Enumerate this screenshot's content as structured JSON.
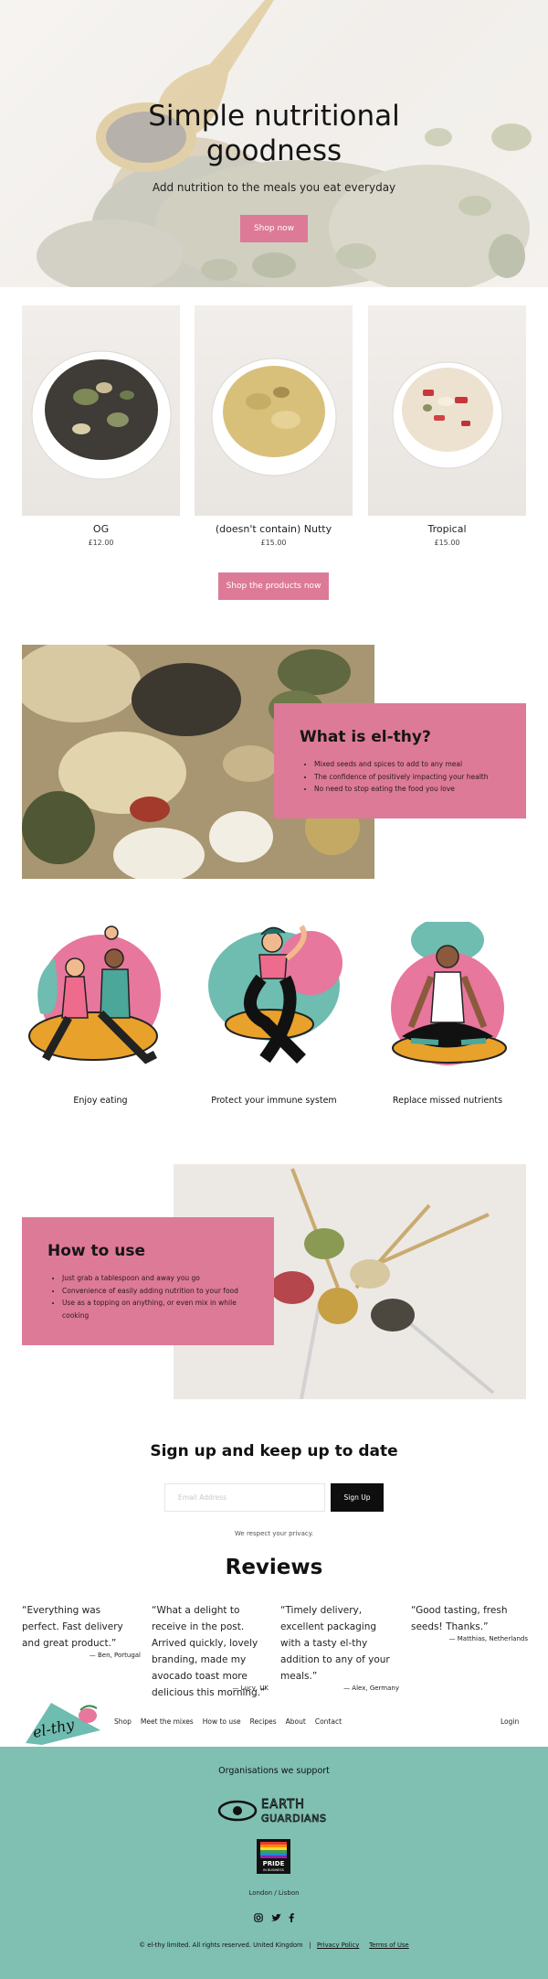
{
  "hero": {
    "title_line1": "Simple nutritional",
    "title_line2": "goodness",
    "subtitle": "Add nutrition to the meals you eat everyday",
    "cta": "Shop now"
  },
  "products": [
    {
      "name": "OG",
      "price": "£12.00"
    },
    {
      "name": "(doesn't contain) Nutty",
      "price": "£15.00"
    },
    {
      "name": "Tropical",
      "price": "£15.00"
    }
  ],
  "products_cta": "Shop the products now",
  "what_is": {
    "title": "What is el-thy?",
    "items": [
      "Mixed seeds and spices to add to any meal",
      "The confidence of positively impacting your health",
      "No need to stop eating the food you love"
    ]
  },
  "features": [
    {
      "label": "Enjoy eating"
    },
    {
      "label": "Protect your immune system"
    },
    {
      "label": "Replace missed nutrients"
    }
  ],
  "how_to_use": {
    "title": "How to use",
    "items": [
      "Just grab a tablespoon and away you go",
      "Convenience of easily adding nutrition to your food",
      "Use as a topping on anything, or even mix in while cooking"
    ]
  },
  "signup": {
    "title": "Sign up and keep up to date",
    "email_placeholder": "Email Address",
    "button": "Sign Up",
    "privacy": "We respect your privacy."
  },
  "reviews": {
    "title": "Reviews",
    "items": [
      {
        "quote": "“Everything was perfect. Fast delivery and great product.”",
        "author": "— Ben, Portugal"
      },
      {
        "quote": "“What a delight to receive in the post. Arrived quickly, lovely branding, made my avocado toast more delicious this morning.”",
        "author": "— Lucy, UK"
      },
      {
        "quote": "“Timely delivery, excellent packaging with a tasty el-thy addition to any of your meals.”",
        "author": "— Alex, Germany"
      },
      {
        "quote": "“Good tasting, fresh seeds! Thanks.”",
        "author": "— Matthias, Netherlands"
      }
    ]
  },
  "nav": {
    "logo_text": "el-thy",
    "links": [
      "Shop",
      "Meet the mixes",
      "How to use",
      "Recipes",
      "About",
      "Contact"
    ],
    "login": "Login"
  },
  "footer": {
    "org_title": "Organisations we support",
    "earth_guardians_top": "EARTH",
    "earth_guardians_bottom": "GUARDIANS",
    "pride_line1": "PRIDE",
    "pride_line2": "IN BUSINESS",
    "location": "London / Lisbon",
    "copyright": "© el-thy limited. All rights reserved. United Kingdom",
    "privacy_policy": "Privacy Policy",
    "terms": "Terms of Use"
  },
  "colors": {
    "accent_pink": "#dd7a98",
    "footer_teal": "#7fc0b3",
    "button_dark": "#0e0e0e"
  },
  "icons": [
    "instagram-icon",
    "twitter-icon",
    "facebook-icon"
  ]
}
